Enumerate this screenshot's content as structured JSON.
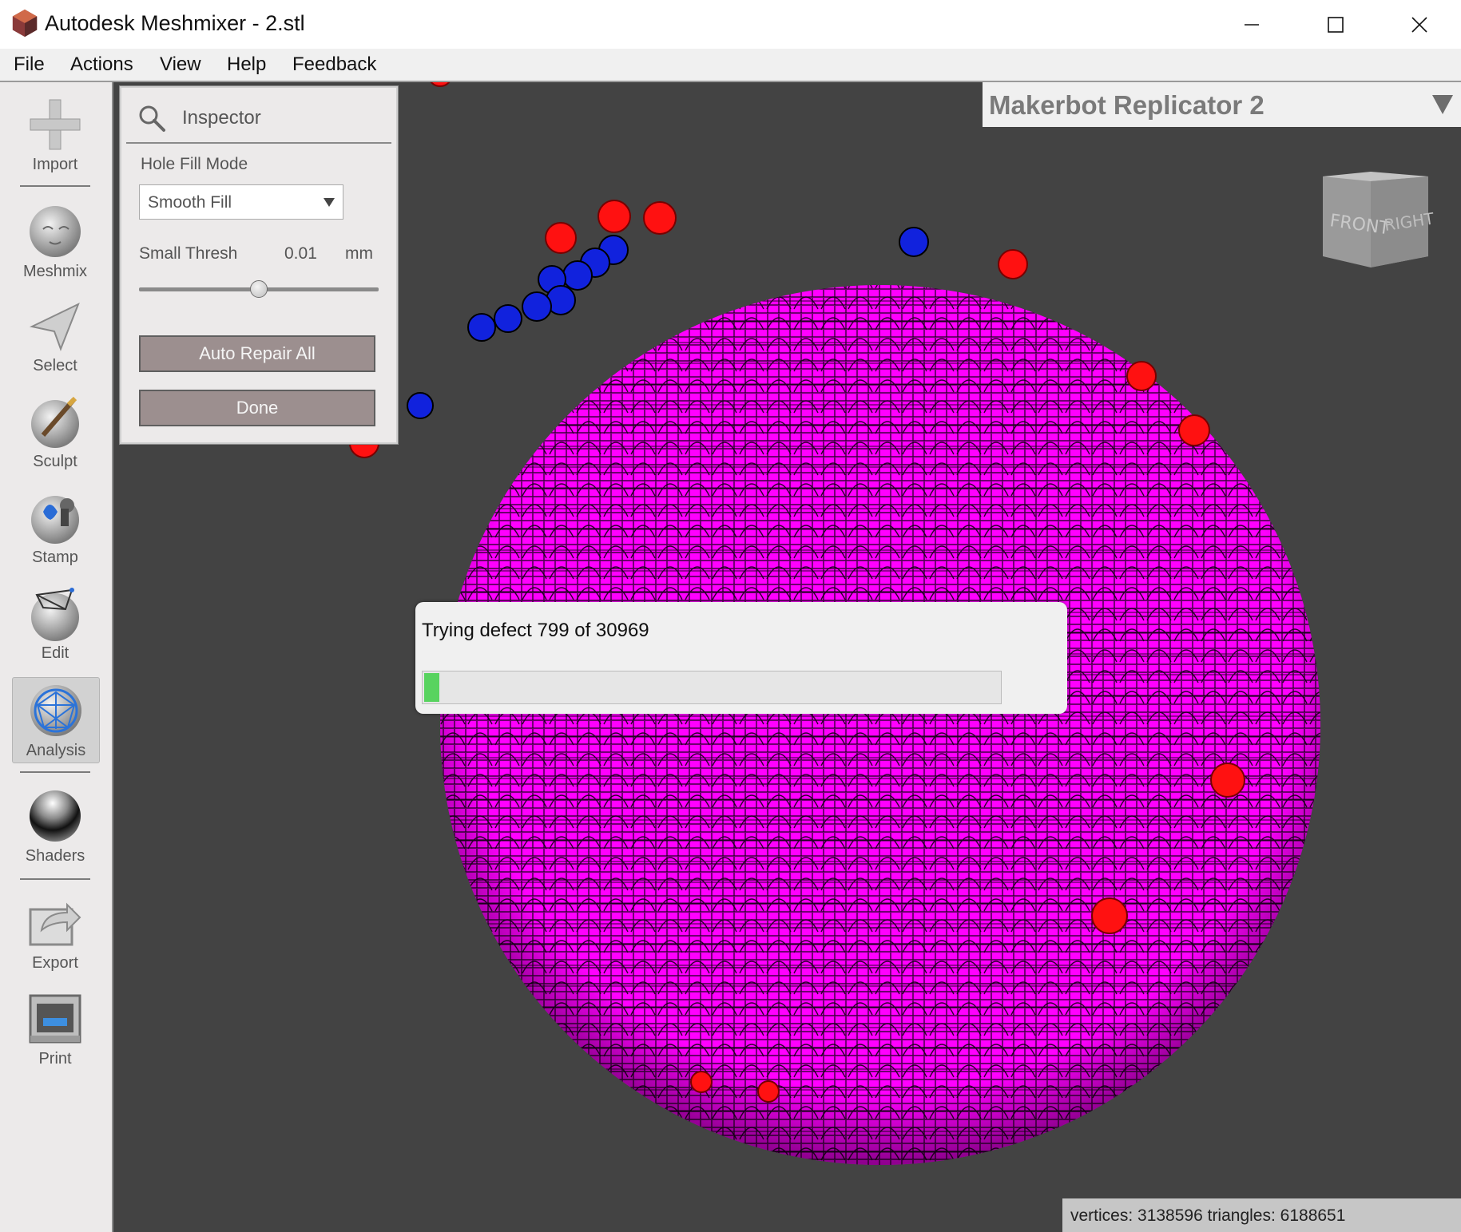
{
  "window": {
    "title": "Autodesk Meshmixer - 2.stl",
    "icon": "meshmixer-logo-icon",
    "controls": [
      "minimize-icon",
      "maximize-icon",
      "close-icon"
    ]
  },
  "menu": {
    "file": "File",
    "actions": "Actions",
    "view": "View",
    "help": "Help",
    "feedback": "Feedback"
  },
  "toolbar": {
    "import": "Import",
    "meshmix": "Meshmix",
    "select": "Select",
    "sculpt": "Sculpt",
    "stamp": "Stamp",
    "edit": "Edit",
    "analysis": "Analysis",
    "shaders": "Shaders",
    "export": "Export",
    "print": "Print",
    "active_tool": "Analysis"
  },
  "inspector": {
    "title": "Inspector",
    "hole_fill_mode_label": "Hole Fill Mode",
    "hole_fill_mode_value": "Smooth Fill",
    "small_thresh_label": "Small Thresh",
    "small_thresh_value": "0.01",
    "small_thresh_unit": "mm",
    "slider_fraction": 0.5,
    "auto_repair_label": "Auto Repair All",
    "done_label": "Done"
  },
  "printer": {
    "name": "Makerbot Replicator 2"
  },
  "view_cube": {
    "front": "FRONT",
    "right": "RIGHT"
  },
  "progress": {
    "text": "Trying defect 799 of 30969",
    "current": 799,
    "total": 30969
  },
  "status": {
    "text": "vertices: 3138596 triangles: 6188651"
  },
  "colors": {
    "viewport_bg": "#434343",
    "mesh": "#ff00ff",
    "defect_red": "#ff1111",
    "defect_blue": "#1122dd",
    "progress_fill": "#58d35f",
    "button_bg": "#9c8f8f"
  }
}
